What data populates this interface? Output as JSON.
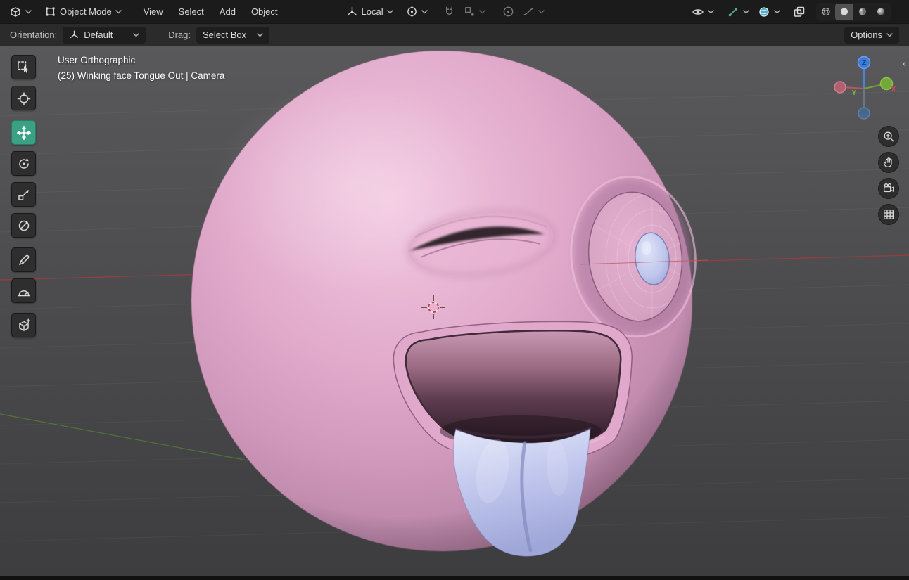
{
  "header": {
    "mode_label": "Object Mode",
    "menus": [
      "View",
      "Select",
      "Add",
      "Object"
    ],
    "transform_orientation": "Local"
  },
  "tool_settings": {
    "orientation_label": "Orientation:",
    "orientation_value": "Default",
    "drag_label": "Drag:",
    "drag_value": "Select Box",
    "options_label": "Options"
  },
  "viewport": {
    "view_text": "User Orthographic",
    "object_text": "(25) Winking face Tongue Out | Camera"
  },
  "nav_gizmo": {
    "x": "X",
    "y": "Y",
    "z": "Z"
  },
  "icons": {
    "sidebar_toggle": "‹"
  },
  "colors": {
    "active_tool": "#3aa184",
    "axis_x": "#b04444",
    "axis_y": "#5d8f35",
    "axis_z": "#3e7bd6",
    "face_pink": "#dfa8ca",
    "tongue_lavender": "#bdc4ec",
    "header_bg": "#1b1b1b",
    "tool_settings_bg": "#2b2b2b"
  }
}
